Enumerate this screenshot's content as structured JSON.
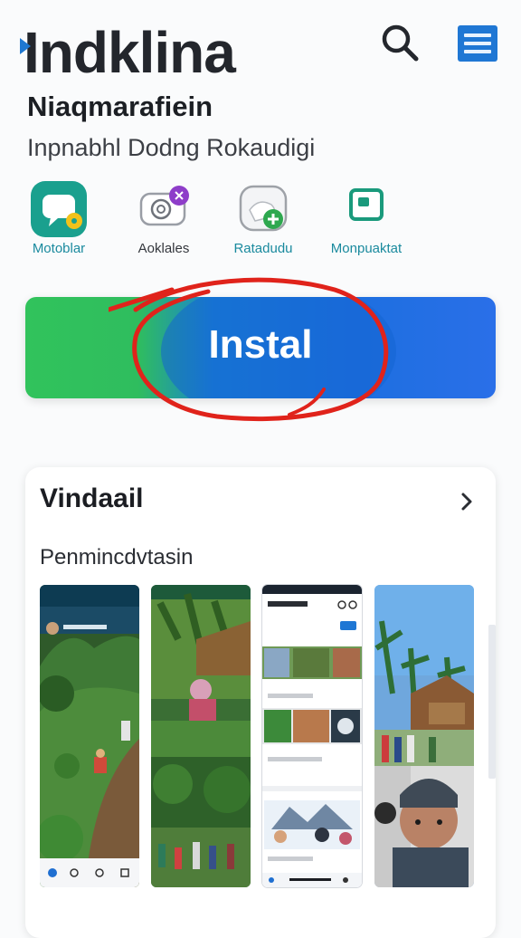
{
  "header": {
    "app_title": "Indklina",
    "search_icon": "search-icon",
    "menu_icon": "hamburger-menu-icon"
  },
  "app_subtitle": "Niaqmarafiein",
  "tagline": "Inpnabhl Dodng Rokaudigi",
  "categories": [
    {
      "label": "Motoblar",
      "icon": "chat-bubble-icon",
      "color": "#1aa08e"
    },
    {
      "label": "Aoklales",
      "icon": "camera-icon",
      "color": "#8e3dc9"
    },
    {
      "label": "Ratadudu",
      "icon": "message-add-icon",
      "color": "#2ea84f"
    },
    {
      "label": "Monpuaktat",
      "icon": "square-app-icon",
      "color": "#1a9a7c"
    }
  ],
  "install": {
    "label": "Instal",
    "color_start": "#31c35c",
    "color_end": "#2a6fe8",
    "annotation_color": "#e0231b"
  },
  "details": {
    "title": "Vindaail",
    "gallery_title": "Penmincdvtasin"
  },
  "screenshots": [
    {
      "name": "screenshot-farm-hills"
    },
    {
      "name": "screenshot-village-jungle"
    },
    {
      "name": "screenshot-social-feed"
    },
    {
      "name": "screenshot-village-portrait"
    }
  ]
}
